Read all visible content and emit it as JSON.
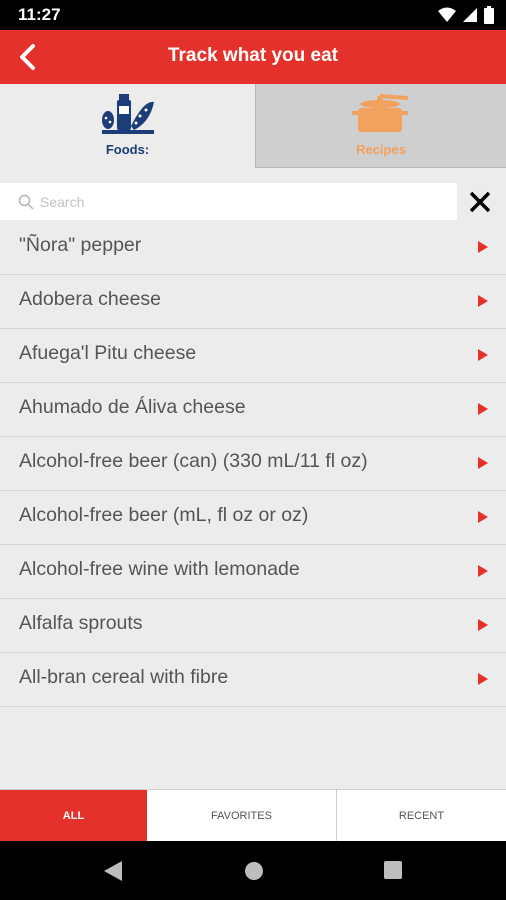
{
  "status_bar": {
    "time": "11:27"
  },
  "app_bar": {
    "title": "Track what you eat"
  },
  "tabs": [
    {
      "label": "Foods:",
      "icon": "groceries-icon",
      "active": true
    },
    {
      "label": "Recipes",
      "icon": "cooking-pot-icon",
      "active": false
    }
  ],
  "search": {
    "placeholder": "Search",
    "value": ""
  },
  "foods": [
    "\"Ñora\" pepper",
    "Adobera cheese",
    "Afuega'l Pitu cheese",
    "Ahumado de Áliva cheese",
    "Alcohol-free beer (can) (330 mL/11 fl oz)",
    "Alcohol-free beer (mL, fl oz or oz)",
    "Alcohol-free wine with lemonade",
    "Alfalfa sprouts",
    "All-bran cereal with fibre"
  ],
  "filters": {
    "all": "ALL",
    "favorites": "FAVORITES",
    "recent": "RECENT"
  },
  "colors": {
    "accent": "#e4312b",
    "foods_tab_text": "#1d3d78",
    "recipes_tab_text": "#f2a25f"
  }
}
